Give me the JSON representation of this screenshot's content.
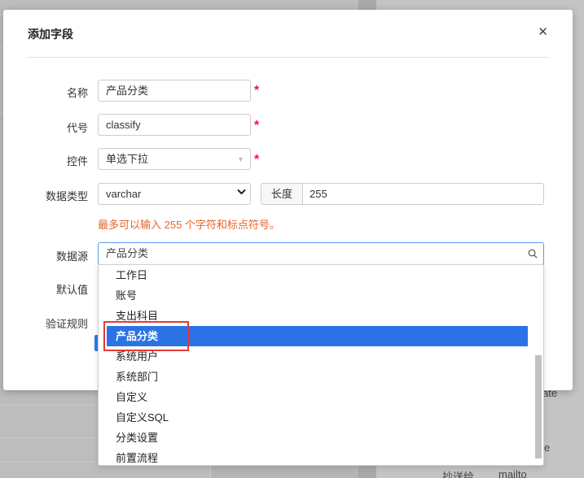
{
  "background": {
    "texts": [
      "ate",
      "e",
      "抄送给",
      "mailto"
    ]
  },
  "modal": {
    "title": "添加字段",
    "close_icon": "close-icon"
  },
  "form": {
    "name": {
      "label": "名称",
      "value": "产品分类",
      "required": "*"
    },
    "code": {
      "label": "代号",
      "value": "classify",
      "required": "*"
    },
    "control": {
      "label": "控件",
      "value": "单选下拉",
      "required": "*",
      "caret_icon": "caret-down-icon"
    },
    "data_type": {
      "label": "数据类型",
      "value": "varchar",
      "length_label": "长度",
      "length_value": "255"
    },
    "hint": "最多可以输入 255 个字符和标点符号。",
    "data_source": {
      "label": "数据源",
      "value": "产品分类",
      "search_icon": "search-icon",
      "options": [
        "工作日",
        "账号",
        "支出科目",
        "产品分类",
        "系统用户",
        "系统部门",
        "自定义",
        "自定义SQL",
        "分类设置",
        "前置流程"
      ],
      "selected": "产品分类"
    },
    "default_value": {
      "label": "默认值"
    },
    "validation": {
      "label": "验证规则"
    }
  },
  "colors": {
    "accent": "#2b73e5",
    "required": "#e6194b",
    "hint": "#e8632a",
    "highlight_box": "#e53935"
  }
}
